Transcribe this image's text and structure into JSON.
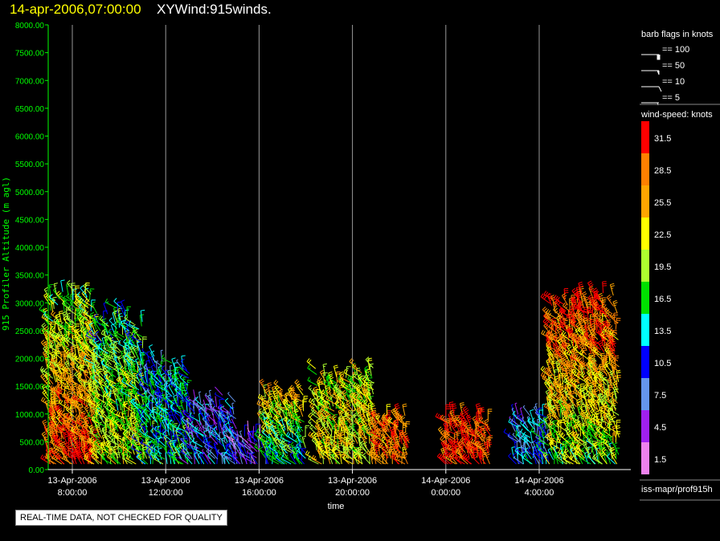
{
  "header": {
    "datetime": "14-apr-2006,07:00:00",
    "title": "XYWind:915winds."
  },
  "note": "REAL-TIME DATA, NOT CHECKED FOR QUALITY",
  "legend": {
    "barb_title": "barb flags in knots",
    "barbs": [
      {
        "label": "== 100",
        "knots": 100
      },
      {
        "label": "== 50",
        "knots": 50
      },
      {
        "label": "== 10",
        "knots": 10
      },
      {
        "label": "== 5",
        "knots": 5
      }
    ],
    "colorbar_title": "wind-speed: knots",
    "colorbar": [
      {
        "label": "31.5",
        "color": "#ff0000"
      },
      {
        "label": "28.5",
        "color": "#ff8000"
      },
      {
        "label": "25.5",
        "color": "#ffa500"
      },
      {
        "label": "22.5",
        "color": "#ffff00"
      },
      {
        "label": "19.5",
        "color": "#adff2f"
      },
      {
        "label": "16.5",
        "color": "#00e000"
      },
      {
        "label": "13.5",
        "color": "#00ffff"
      },
      {
        "label": "10.5",
        "color": "#0000ff"
      },
      {
        "label": "7.5",
        "color": "#6495ed"
      },
      {
        "label": "4.5",
        "color": "#a020f0"
      },
      {
        "label": "1.5",
        "color": "#ee82ee"
      }
    ],
    "source": "iss-mapr/prof915h"
  },
  "chart_data": {
    "type": "scatter",
    "subtype": "wind-barb time-height",
    "xlabel": "time",
    "ylabel": "915 Profiler Altitude (m agl)",
    "ylim": [
      0,
      8000
    ],
    "xlim": [
      "13-Apr-2006 07:00",
      "14-Apr-2006 08:00"
    ],
    "yticks": [
      "0.00",
      "500.00",
      "1000.00",
      "1500.00",
      "2000.00",
      "2500.00",
      "3000.00",
      "3500.00",
      "4000.00",
      "4500.00",
      "5000.00",
      "5500.00",
      "6000.00",
      "6500.00",
      "7000.00",
      "7500.00",
      "8000.00"
    ],
    "xticks": [
      {
        "date": "13-Apr-2006",
        "time": "8:00:00"
      },
      {
        "date": "13-Apr-2006",
        "time": "12:00:00"
      },
      {
        "date": "13-Apr-2006",
        "time": "16:00:00"
      },
      {
        "date": "13-Apr-2006",
        "time": "20:00:00"
      },
      {
        "date": "14-Apr-2006",
        "time": "0:00:00"
      },
      {
        "date": "14-Apr-2006",
        "time": "4:00:00"
      }
    ],
    "grid": "vertical lines at x ticks",
    "profiles": [
      {
        "start": "13-Apr-2006 07:00",
        "end": "13-Apr-2006 09:00",
        "top_m": 3100,
        "speed_kt_low": 31,
        "speed_kt_high": 18
      },
      {
        "start": "13-Apr-2006 09:00",
        "end": "13-Apr-2006 11:00",
        "top_m": 2900,
        "speed_kt_low": 22,
        "speed_kt_high": 14
      },
      {
        "start": "13-Apr-2006 11:00",
        "end": "13-Apr-2006 13:00",
        "top_m": 2000,
        "speed_kt_low": 15,
        "speed_kt_high": 12
      },
      {
        "start": "13-Apr-2006 13:00",
        "end": "13-Apr-2006 15:00",
        "top_m": 1300,
        "speed_kt_low": 10,
        "speed_kt_high": 8
      },
      {
        "start": "13-Apr-2006 15:00",
        "end": "13-Apr-2006 16:00",
        "top_m": 700,
        "speed_kt_low": 8,
        "speed_kt_high": 6
      },
      {
        "start": "13-Apr-2006 16:15",
        "end": "13-Apr-2006 18:00",
        "top_m": 1500,
        "speed_kt_low": 12,
        "speed_kt_high": 26
      },
      {
        "start": "13-Apr-2006 18:30",
        "end": "13-Apr-2006 21:00",
        "top_m": 1800,
        "speed_kt_low": 23,
        "speed_kt_high": 20
      },
      {
        "start": "13-Apr-2006 21:00",
        "end": "13-Apr-2006 22:30",
        "top_m": 1000,
        "speed_kt_low": 28,
        "speed_kt_high": 28
      },
      {
        "start": "14-Apr-2006 00:00",
        "end": "14-Apr-2006 02:00",
        "top_m": 1000,
        "speed_kt_low": 31,
        "speed_kt_high": 31
      },
      {
        "start": "14-Apr-2006 03:00",
        "end": "14-Apr-2006 04:30",
        "top_m": 1000,
        "speed_kt_low": 12,
        "speed_kt_high": 10
      },
      {
        "start": "14-Apr-2006 04:30",
        "end": "14-Apr-2006 07:30",
        "top_m": 3100,
        "speed_kt_low": 18,
        "speed_kt_high": 31
      }
    ]
  }
}
